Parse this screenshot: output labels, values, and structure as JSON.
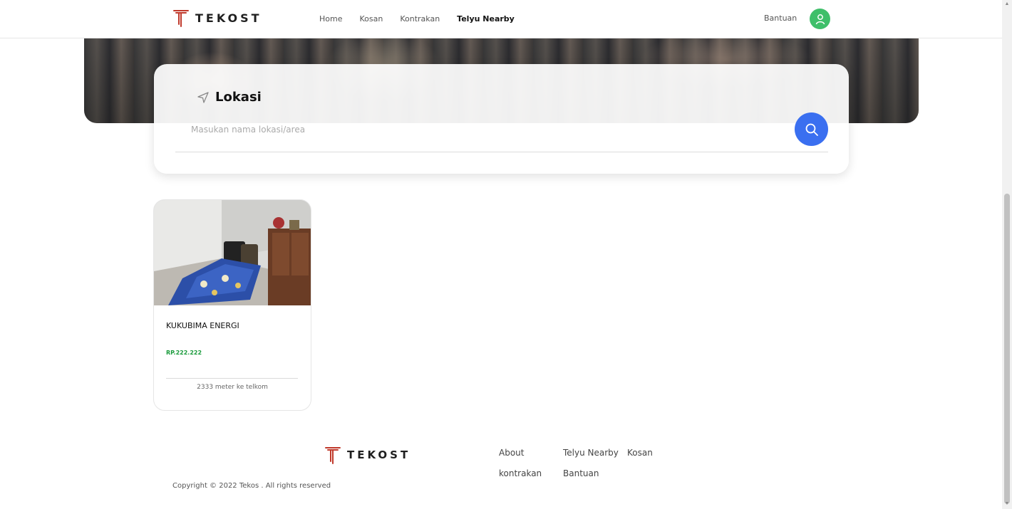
{
  "header": {
    "brand": "TEKOST",
    "nav": [
      {
        "label": "Home",
        "active": false
      },
      {
        "label": "Kosan",
        "active": false
      },
      {
        "label": "Kontrakan",
        "active": false
      },
      {
        "label": "Telyu Nearby",
        "active": true
      }
    ],
    "help": "Bantuan",
    "avatar_icon": "user-icon",
    "avatar_color": "#3fbf6a"
  },
  "search": {
    "title": "Lokasi",
    "title_icon": "navigation-arrow-icon",
    "placeholder": "Masukan nama lokasi/area",
    "value": "",
    "button_icon": "search-icon",
    "button_color": "#3a6ff0"
  },
  "listings": [
    {
      "name": "KUKUBIMA ENERGI",
      "price": "RP.222.222",
      "price_color": "#1a9b3c",
      "distance": "2333 meter ke telkom"
    }
  ],
  "footer": {
    "brand": "TEKOST",
    "links": [
      "About",
      "Telyu Nearby",
      "Kosan",
      "kontrakan",
      "Bantuan"
    ],
    "copyright": "Copyright © 2022 Tekos . All rights reserved"
  },
  "colors": {
    "brand_logo": "#c0392b",
    "accent": "#3a6ff0"
  }
}
